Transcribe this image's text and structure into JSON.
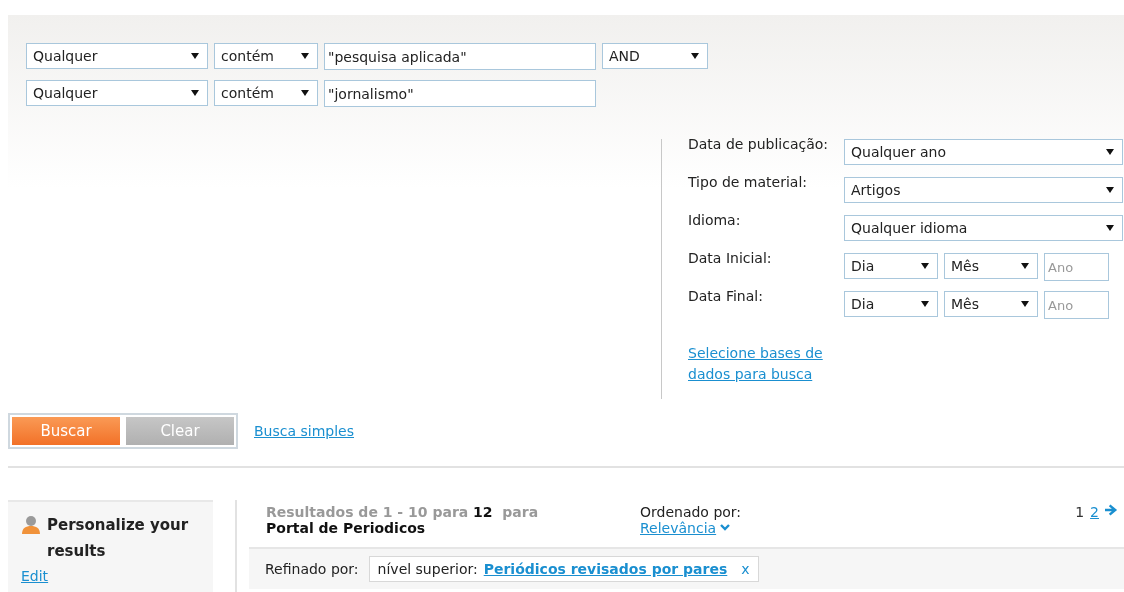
{
  "query_rows": [
    {
      "field": "Qualquer",
      "operator": "contém",
      "term": "\"pesquisa aplicada\"",
      "boolean": "AND"
    },
    {
      "field": "Qualquer",
      "operator": "contém",
      "term": "\"jornalismo\""
    }
  ],
  "filters": [
    {
      "kind": "select",
      "label": "Data de publicação:",
      "value": "Qualquer ano"
    },
    {
      "kind": "select",
      "label": "Tipo de material:",
      "value": "Artigos"
    },
    {
      "kind": "select",
      "label": "Idioma:",
      "value": "Qualquer idioma"
    },
    {
      "kind": "date",
      "label": "Data Inicial:",
      "day": "Dia",
      "month": "Mês",
      "year_placeholder": "Ano"
    },
    {
      "kind": "date",
      "label": "Data Final:",
      "day": "Dia",
      "month": "Mês",
      "year_placeholder": "Ano"
    }
  ],
  "databases_link": "Selecione bases de dados para busca",
  "buttons": {
    "search": "Buscar",
    "clear": "Clear"
  },
  "simple_search_link": "Busca simples",
  "personalize": {
    "title": "Personalize your results",
    "edit_link": "Edit"
  },
  "results": {
    "summary": "Resultados de 1 - 10 para **12**  para",
    "source": "Portal de Periodicos",
    "sort_label": "Ordenado por:",
    "sort_value": "Relevância",
    "pages": [
      {
        "label": "1",
        "selected": true
      },
      {
        "label": "2",
        "selected": false
      }
    ],
    "refined_label": "Refinado por:",
    "facet_label": "nível superior:",
    "facet_value": "Periódicos revisados por pares",
    "remove": "x"
  }
}
